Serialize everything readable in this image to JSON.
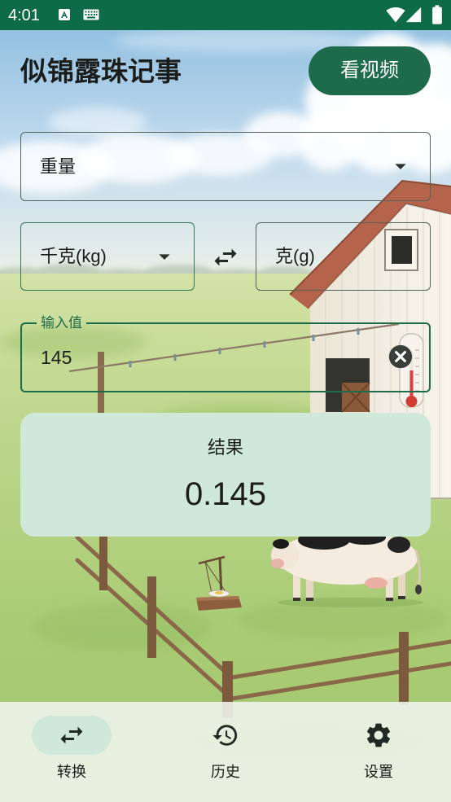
{
  "status_bar": {
    "time": "4:01",
    "left_icons": [
      "app-notification-icon",
      "keyboard-icon"
    ],
    "right_icons": [
      "wifi-icon",
      "signal-icon",
      "battery-icon"
    ]
  },
  "app_bar": {
    "title": "似锦露珠记事",
    "video_button_label": "看视频"
  },
  "converter": {
    "category": {
      "selected": "重量",
      "icon": "arrow-drop-down-icon"
    },
    "from_unit": {
      "selected": "千克(kg)",
      "icon": "arrow-drop-down-icon"
    },
    "swap_icon": "swap-horiz-icon",
    "to_unit": {
      "selected": "克(g)"
    },
    "input": {
      "label": "输入值",
      "value": "145",
      "clear_icon": "cancel-icon"
    },
    "result": {
      "label": "结果",
      "value": "0.145"
    }
  },
  "bottom_nav": {
    "items": [
      {
        "label": "转换",
        "icon": "swap-horiz-icon",
        "selected": true
      },
      {
        "label": "历史",
        "icon": "history-icon",
        "selected": false
      },
      {
        "label": "设置",
        "icon": "settings-gear-icon",
        "selected": false
      }
    ]
  },
  "colors": {
    "status_bar": "#0e6b48",
    "primary": "#1d6b4b",
    "result_card": "#cfe8da",
    "nav_selected_pill": "#cfe8da",
    "text": "#1b1d1b"
  }
}
